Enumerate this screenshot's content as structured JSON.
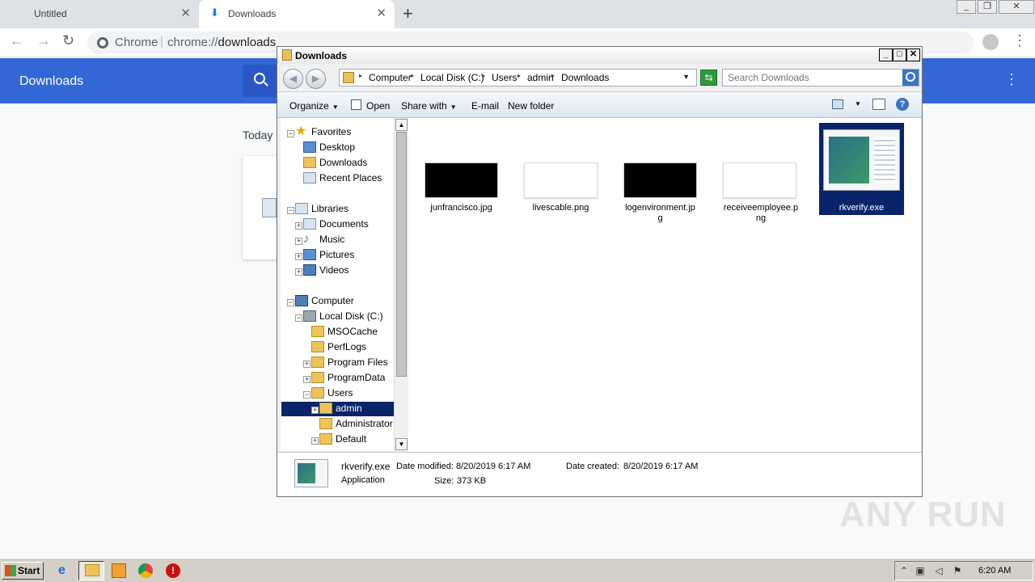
{
  "chrome": {
    "tabs": [
      {
        "label": "Untitled"
      },
      {
        "label": "Downloads"
      }
    ],
    "omnibox": {
      "site_label": "Chrome",
      "separator": "|",
      "url_scheme": "chrome://",
      "url_host": "downloads"
    },
    "downloads_page": {
      "title": "Downloads",
      "section_label": "Today"
    }
  },
  "explorer": {
    "title": "Downloads",
    "breadcrumb": [
      "Computer",
      "Local Disk (C:)",
      "Users",
      "admin",
      "Downloads"
    ],
    "search_placeholder": "Search Downloads",
    "commands": {
      "organize": "Organize",
      "open": "Open",
      "share_with": "Share with",
      "email": "E-mail",
      "new_folder": "New folder"
    },
    "nav_tree": {
      "favorites": "Favorites",
      "favorites_items": [
        "Desktop",
        "Downloads",
        "Recent Places"
      ],
      "libraries": "Libraries",
      "libraries_items": [
        "Documents",
        "Music",
        "Pictures",
        "Videos"
      ],
      "computer": "Computer",
      "local_disk": "Local Disk (C:)",
      "disk_items": [
        "MSOCache",
        "PerfLogs",
        "Program Files",
        "ProgramData",
        "Users"
      ],
      "users_items": [
        "admin",
        "Administrator",
        "Default"
      ]
    },
    "files": [
      {
        "name": "junfrancisco.jpg",
        "thumb": "black"
      },
      {
        "name": "livescable.png",
        "thumb": "white"
      },
      {
        "name": "logenvironment.jpg",
        "thumb": "black"
      },
      {
        "name": "receiveemployee.png",
        "thumb": "white"
      },
      {
        "name": "rkverify.exe",
        "thumb": "app",
        "selected": true
      }
    ],
    "details": {
      "name": "rkverify.exe",
      "type": "Application",
      "date_modified_label": "Date modified:",
      "date_modified": "8/20/2019 6:17 AM",
      "date_created_label": "Date created:",
      "date_created": "8/20/2019 6:17 AM",
      "size_label": "Size:",
      "size": "373 KB"
    }
  },
  "watermark": "ANY RUN",
  "taskbar": {
    "start_label": "Start",
    "clock": "6:20 AM"
  },
  "colors": {
    "chrome_blue": "#3367d6",
    "selection": "#0a246a",
    "taskbar": "#d4d0c8"
  }
}
